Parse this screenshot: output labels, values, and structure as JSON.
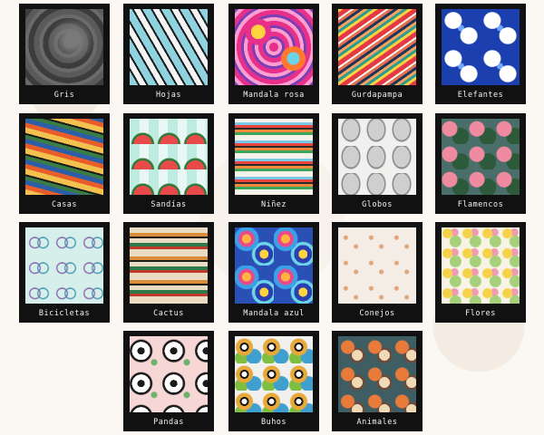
{
  "fabrics": [
    {
      "label": "Gris",
      "icon": "gray-fabric-swatch"
    },
    {
      "label": "Hojas",
      "icon": "leaves-fabric-swatch"
    },
    {
      "label": "Mandala rosa",
      "icon": "pink-mandala-fabric-swatch"
    },
    {
      "label": "Gurdapampa",
      "icon": "striped-fabric-swatch"
    },
    {
      "label": "Elefantes",
      "icon": "elephants-fabric-swatch"
    },
    {
      "label": "Casas",
      "icon": "houses-fabric-swatch"
    },
    {
      "label": "Sandías",
      "icon": "watermelon-fabric-swatch"
    },
    {
      "label": "Niñez",
      "icon": "childhood-fabric-swatch"
    },
    {
      "label": "Globos",
      "icon": "balloons-fabric-swatch"
    },
    {
      "label": "Flamencos",
      "icon": "flamingos-fabric-swatch"
    },
    {
      "label": "Bicicletas",
      "icon": "bicycles-fabric-swatch"
    },
    {
      "label": "Cactus",
      "icon": "cactus-fabric-swatch"
    },
    {
      "label": "Mandala azul",
      "icon": "blue-mandala-fabric-swatch"
    },
    {
      "label": "Conejos",
      "icon": "rabbits-fabric-swatch"
    },
    {
      "label": "Flores",
      "icon": "flowers-fabric-swatch"
    },
    {
      "label": "Pandas",
      "icon": "pandas-fabric-swatch"
    },
    {
      "label": "Buhos",
      "icon": "owls-fabric-swatch"
    },
    {
      "label": "Animales",
      "icon": "animals-fabric-swatch"
    }
  ],
  "colors": {
    "background": "#fbf8f4",
    "frame": "#111111",
    "label_text": "#f2f2f2"
  }
}
